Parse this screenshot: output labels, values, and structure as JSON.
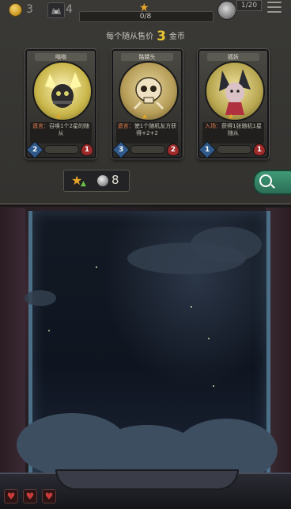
{
  "topbar": {
    "gold": "3",
    "tier": "4",
    "xp_text": "0/8",
    "turn_text": "1/20"
  },
  "shop": {
    "sell_prefix": "每个随从售价",
    "sell_value": "3",
    "sell_suffix": "金币",
    "cards": [
      {
        "name": "嗡嗡",
        "keyword": "遗言：",
        "text": "召唤1个2星的随从",
        "attack": "2",
        "health": "1"
      },
      {
        "name": "骷髅头",
        "keyword": "遗言：",
        "text": "使1个随机友方获得+2+2",
        "attack": "3",
        "health": "2"
      },
      {
        "name": "狐妖",
        "keyword": "入场：",
        "text": "获得1张随机1星随从",
        "attack": "1",
        "health": "1"
      }
    ],
    "upgrade_cost": "8"
  },
  "colors": {
    "gold": "#e8c533",
    "star": "#e7a52a",
    "keyword": "#e47b4e",
    "refresh": "#3f9a77",
    "heart": "#c73b3b"
  },
  "icons": {
    "coin": "coin-icon",
    "tier": "tier-icon",
    "star": "star-icon",
    "menu": "menu-icon",
    "search": "search-icon",
    "heart": "heart-icon"
  },
  "lives": [
    "♥",
    "♥",
    "♥"
  ]
}
